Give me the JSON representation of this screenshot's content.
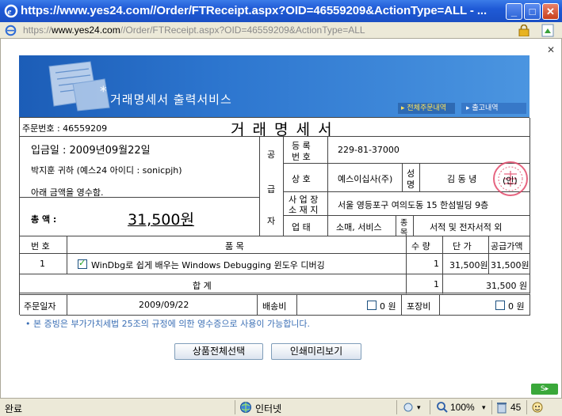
{
  "window": {
    "title": "https://www.yes24.com//Order/FTReceipt.aspx?OID=46559209&ActionType=ALL - ...",
    "minimize": "_",
    "maximize": "□",
    "close": "✕"
  },
  "address": {
    "url_prefix": "https://",
    "url_host": "www.yes24.com",
    "url_path": "//Order/FTReceipt.aspx?OID=46559209&ActionType=ALL"
  },
  "page_close": "✕",
  "banner": {
    "star": "*",
    "title": "거래명세서 출력서비스",
    "tab_all_orders": "▸ 전체주문내역",
    "tab_shipping": "▸ 출고내역"
  },
  "receipt": {
    "order_no_label": "주문번호 : 46559209",
    "doc_title": "거 래 명 세 서",
    "deposit_date": "입금일 : 2009년09월22일",
    "customer": "박지훈 귀하 (예스24 아이디 : sonicpjh)",
    "received_note": "아래 금액을 영수함.",
    "total_label": "총  액 :",
    "total_amount": "31,500원",
    "supplier_label_1": "공",
    "supplier_label_2": "급",
    "supplier_label_3": "자",
    "reg_no_label": "등 록\n번 호",
    "reg_no_label_top": "등  록",
    "reg_no_label_bottom": "번  호",
    "reg_no_value": "229-81-37000",
    "company_label": "상  호",
    "company_value": "예스이십사(주)",
    "name_label_top": "성",
    "name_label_bottom": "명",
    "name_value": "김 동 녕",
    "stamp_text": "(인)",
    "addr_label_top": "사 업 장",
    "addr_label_bottom": "소 재 지",
    "addr_value": "서울 영등포구 여의도동 15 한섬빌딩 9층",
    "biz_label": "업  태",
    "biz_value": "소매, 서비스",
    "item_label_top": "종",
    "item_label_bottom": "목",
    "item_value": "서적 및 전자서적 외",
    "col_no": "번 호",
    "col_item": "품 목",
    "col_qty": "수 량",
    "col_unit": "단  가",
    "col_supply": "공급가액",
    "rows": [
      {
        "no": "1",
        "item": "WinDbg로 쉽게 배우는 Windows Debugging 윈도우 디버깅",
        "qty": "1",
        "unit": "31,500원",
        "supply": "31,500원"
      }
    ],
    "sum_label": "합     계",
    "sum_qty": "1",
    "sum_amount": "31,500 원",
    "order_date_label": "주문일자",
    "order_date_value": "2009/09/22",
    "shipping_label": "배송비",
    "shipping_value": "0 원",
    "packing_label": "포장비",
    "packing_value": "0 원"
  },
  "notice": "• 본 증빙은 부가가치세법 25조의 규정에 의한 영수증으로 사용이 가능합니다.",
  "buttons": {
    "select_all": "상품전체선택",
    "print_preview": "인쇄미리보기"
  },
  "status": {
    "done": "완료",
    "zone": "인터넷",
    "zoom": "100%",
    "count": "45"
  },
  "colors": {
    "titlebar": "#1f5ad6",
    "banner": "#2d76cf",
    "notice": "#3b6fb5",
    "stamp": "#e24a6b"
  }
}
